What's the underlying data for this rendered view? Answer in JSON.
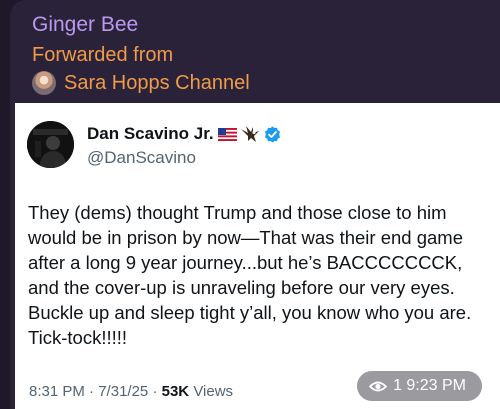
{
  "message": {
    "sender": "Ginger Bee",
    "forwarded_label": "Forwarded from",
    "channel_name": "Sara Hopps Channel",
    "views_time": "1 9:23 PM"
  },
  "tweet": {
    "author_name": "Dan Scavino Jr.",
    "author_handle": "@DanScavino",
    "text": "They (dems) thought Trump and those close to him would be in prison by now—That was their end game after a long 9 year journey...but he’s BACCCCCCCK, and the cover-up is unraveling before our very eyes. Buckle up and sleep tight y’all, you know who you are. Tick-tock!!!!!",
    "time": "8:31 PM",
    "date": "7/31/25",
    "views_count": "53K",
    "views_label": "Views"
  },
  "icons": {
    "verified": "verified-badge-icon",
    "flag": "us-flag-icon",
    "eagle": "eagle-icon",
    "views": "eye-icon"
  },
  "colors": {
    "sender": "#b99af0",
    "forward": "#f09a4a",
    "verified": "#1d9bf0",
    "background": "#1e1828"
  }
}
